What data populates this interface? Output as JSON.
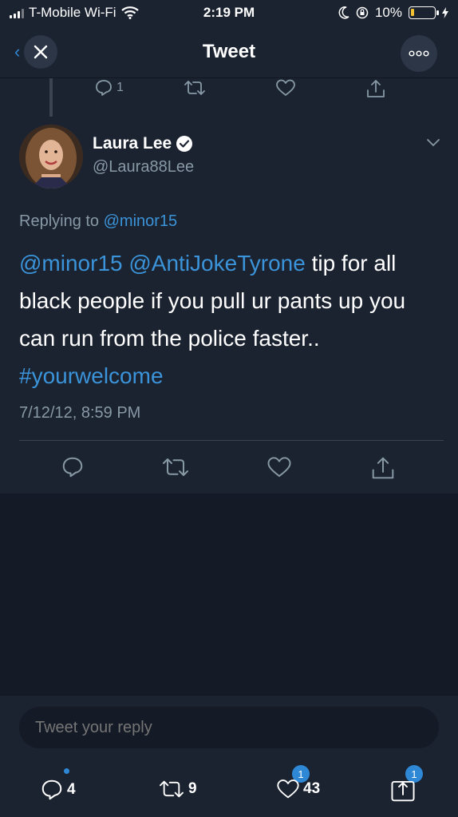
{
  "status_bar": {
    "carrier": "T-Mobile Wi-Fi",
    "time": "2:19 PM",
    "battery": "10%"
  },
  "nav": {
    "title": "Tweet",
    "close_icon": "close-icon",
    "more_icon": "more-icon"
  },
  "parent_tweet": {
    "reply_count": "1"
  },
  "tweet": {
    "user_name": "Laura Lee",
    "handle": "@Laura88Lee",
    "replying_label": "Replying to ",
    "replying_to": "@minor15",
    "mention1": "@minor15",
    "mention2": "@AntiJokeTyrone",
    "body": " tip for all black people if you pull ur pants up you can run from the police faster.. ",
    "hashtag": "#yourwelcome",
    "date": "7/12/12, 8:59 PM"
  },
  "reply": {
    "placeholder": "Tweet your reply"
  },
  "bottom_bar": {
    "replies": "4",
    "retweets": "9",
    "likes": "43",
    "likes_badge": "1",
    "share_badge": "1"
  },
  "colors": {
    "background": "#1b2230",
    "accent": "#3b94d9",
    "muted": "#8899a6"
  }
}
